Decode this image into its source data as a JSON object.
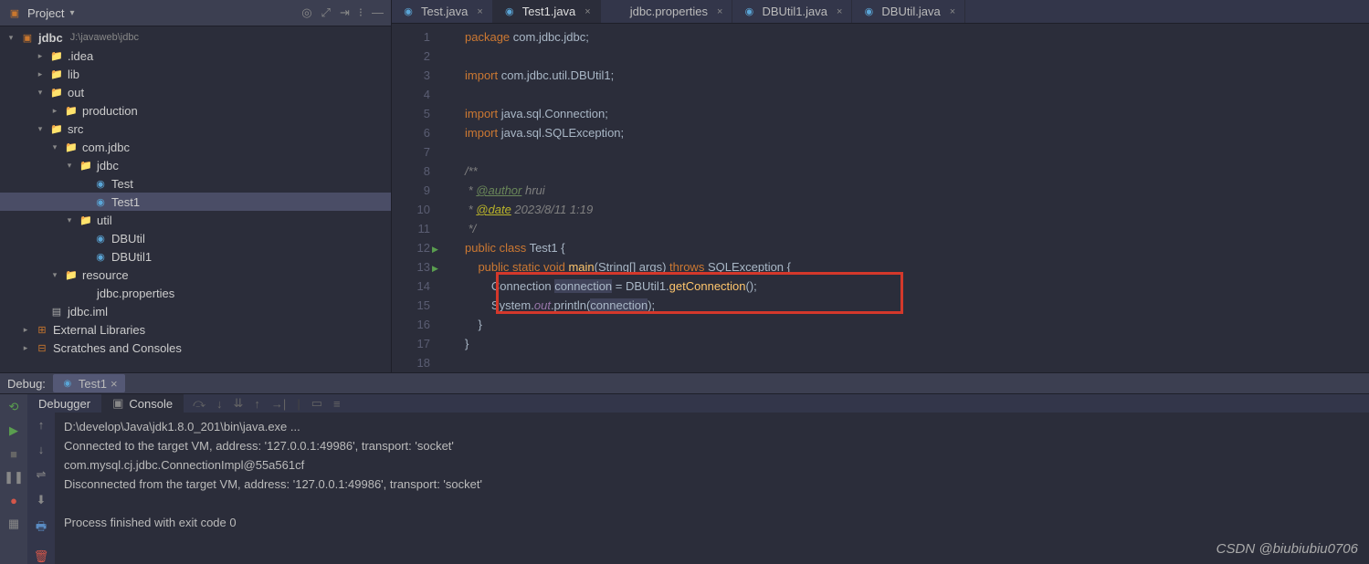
{
  "sidebar": {
    "title": "Project",
    "tree": {
      "root": {
        "name": "jdbc",
        "path": "J:\\javaweb\\jdbc"
      },
      "items": [
        {
          "indent": 1,
          "arrow": ">",
          "type": "fold-blue",
          "name": ".idea"
        },
        {
          "indent": 1,
          "arrow": ">",
          "type": "fold",
          "name": "lib"
        },
        {
          "indent": 1,
          "arrow": "v",
          "type": "fold-red",
          "name": "out"
        },
        {
          "indent": 2,
          "arrow": ">",
          "type": "fold",
          "name": "production"
        },
        {
          "indent": 1,
          "arrow": "v",
          "type": "fold-blue",
          "name": "src"
        },
        {
          "indent": 2,
          "arrow": "v",
          "type": "fold",
          "name": "com.jdbc"
        },
        {
          "indent": 3,
          "arrow": "v",
          "type": "fold",
          "name": "jdbc"
        },
        {
          "indent": 4,
          "arrow": "",
          "type": "cls",
          "name": "Test"
        },
        {
          "indent": 4,
          "arrow": "",
          "type": "cls",
          "name": "Test1",
          "sel": true
        },
        {
          "indent": 3,
          "arrow": "v",
          "type": "fold",
          "name": "util"
        },
        {
          "indent": 4,
          "arrow": "",
          "type": "cls",
          "name": "DBUtil"
        },
        {
          "indent": 4,
          "arrow": "",
          "type": "cls",
          "name": "DBUtil1"
        },
        {
          "indent": 2,
          "arrow": "v",
          "type": "fold-teal",
          "name": "resource"
        },
        {
          "indent": 3,
          "arrow": "",
          "type": "prop",
          "name": "jdbc.properties"
        },
        {
          "indent": 1,
          "arrow": "",
          "type": "file",
          "name": "jdbc.iml"
        },
        {
          "indent": 0,
          "arrow": ">",
          "type": "lib",
          "name": "External Libraries"
        },
        {
          "indent": 0,
          "arrow": ">",
          "type": "scratch",
          "name": "Scratches and Consoles"
        }
      ]
    }
  },
  "tabs": [
    {
      "icon": "cls",
      "label": "Test.java",
      "active": false
    },
    {
      "icon": "cls",
      "label": "Test1.java",
      "active": true
    },
    {
      "icon": "prop",
      "label": "jdbc.properties",
      "active": false
    },
    {
      "icon": "cls",
      "label": "DBUtil1.java",
      "active": false
    },
    {
      "icon": "cls",
      "label": "DBUtil.java",
      "active": false
    }
  ],
  "code": {
    "lines": [
      "1",
      "2",
      "3",
      "4",
      "5",
      "6",
      "7",
      "8",
      "9",
      "10",
      "11",
      "12",
      "13",
      "14",
      "15",
      "16",
      "17",
      "18"
    ],
    "l1_kw": "package",
    "l1_pkg": " com.jdbc.jdbc;",
    "l3_kw": "import",
    "l3_pkg": " com.jdbc.util.DBUtil1;",
    "l5_kw": "import",
    "l5_pkg": " java.sql.Connection;",
    "l6_kw": "import",
    "l6_pkg": " java.sql.SQLException;",
    "l8": "/**",
    "l9_a": " * ",
    "l9_tag": "@author",
    "l9_b": " hrui",
    "l10_a": " * ",
    "l10_tag": "@date",
    "l10_b": " 2023/8/11 1:19",
    "l11": " */",
    "l12_a": "public class ",
    "l12_b": "Test1 {",
    "l13_a": "    public static void ",
    "l13_m": "main",
    "l13_b": "(",
    "l13_t": "String",
    "l13_c": "[] args) ",
    "l13_th": "throws ",
    "l13_ex": "SQLException ",
    "l13_d": "{",
    "l14_a": "        Connection ",
    "l14_v": "connection",
    "l14_b": " = DBUtil1.",
    "l14_m": "getConnection",
    "l14_c": "();",
    "l15_a": "        System.",
    "l15_f": "out",
    "l15_b": ".println(",
    "l15_v": "connection",
    "l15_c": ");",
    "l16": "    }",
    "l17": "}"
  },
  "debug": {
    "title": "Debug:",
    "tab": "Test1",
    "subtabs": {
      "debugger": "Debugger",
      "console": "Console"
    }
  },
  "console": {
    "l1": "D:\\develop\\Java\\jdk1.8.0_201\\bin\\java.exe ...",
    "l2": "Connected to the target VM, address: '127.0.0.1:49986', transport: 'socket'",
    "l3": "com.mysql.cj.jdbc.ConnectionImpl@55a561cf",
    "l4": "Disconnected from the target VM, address: '127.0.0.1:49986', transport: 'socket'",
    "l5": "",
    "l6": "Process finished with exit code 0"
  },
  "watermark": "CSDN @biubiubiu0706"
}
